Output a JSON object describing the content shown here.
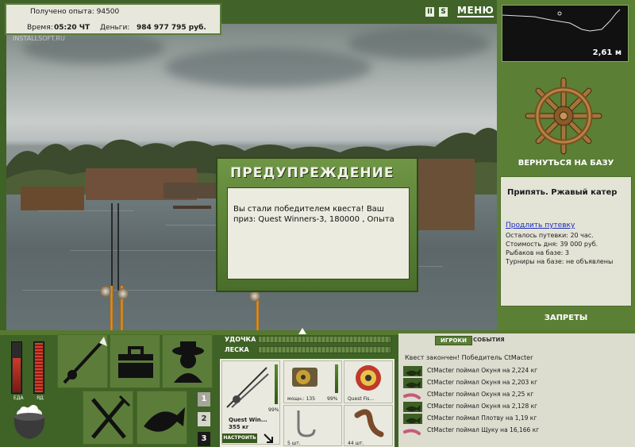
{
  "hud": {
    "experience_label": "Получено опыта:",
    "experience_value": "94500",
    "time_label": "Время:",
    "time_value": "05:20 ЧТ",
    "money_label": "Деньги:",
    "money_value": "984 977 795 руб.",
    "watermark": "INSTALLSOFT.RU"
  },
  "top_controls": {
    "pause_label": "II",
    "sound_label": "S",
    "menu_label": "МЕНЮ"
  },
  "depth_map": {
    "depth_value": "2,61 м"
  },
  "right_panel": {
    "base_button_label": "ВЕРНУТЬСЯ НА БАЗУ",
    "location_title": "Припять. Ржавый катер",
    "extend_link": "Продлить путевку",
    "info_lines": [
      "Осталось путевки: 20 час.",
      "Стоимость дня: 39 000 руб.",
      "Рыбаков на базе: 3",
      "Турниры на базе: не объявлены"
    ],
    "bans_button_label": "ЗАПРЕТЫ"
  },
  "modal": {
    "title": "ПРЕДУПРЕЖДЕНИЕ",
    "message": "Вы стали победителем квеста! Ваш приз: Quest Winners-3, 180000 , Опыта"
  },
  "gauges": {
    "food_label": "ЕДА",
    "food_level": 0.7,
    "drink_label": "ЯД",
    "drink_level": 1.0
  },
  "quick_slots": {
    "numbers": [
      "1",
      "2",
      "3"
    ],
    "active": "3"
  },
  "status_bars": {
    "rod_label": "УДОЧКА",
    "line_label": "ЛЕСКА"
  },
  "tackle": {
    "rod_name": "Quest Win...",
    "rod_weight": "355 кг",
    "rod_percent": "99%",
    "reel_label": "мощн.: 135",
    "reel_percent": "99%",
    "line_label": "Quest Fis...",
    "hook_label": "5 шт.",
    "bait_label": "44 шт.",
    "setup_button_label": "НАСТРОИТЬ"
  },
  "events": {
    "tab_players": "ИГРОКИ",
    "tab_events": "СОБЫТИЯ",
    "header": "Квест закончен! Победитель CtMacter",
    "rows": [
      {
        "text": "CtMacter поймал Окуня на 2,224 кг",
        "icon": "fish-icon"
      },
      {
        "text": "CtMacter поймал Окуня на 2,203 кг",
        "icon": "fish-icon"
      },
      {
        "text": "CtMacter поймал Окуня на 2,25 кг",
        "icon": "lure-icon"
      },
      {
        "text": "CtMacter поймал Окуня на 2,128 кг",
        "icon": "fish-icon"
      },
      {
        "text": "CtMacter поймал Плотву на 1,19 кг",
        "icon": "fish-icon"
      },
      {
        "text": "CtMacter поймал Щуку на 16,166 кг",
        "icon": "lure-icon"
      }
    ]
  },
  "colors": {
    "panel_green": "#5b7f35",
    "dark_green": "#3f6226",
    "modal_green": "#6f9545",
    "text_panel": "#e7e7dc",
    "link_blue": "#1a2bbf"
  }
}
